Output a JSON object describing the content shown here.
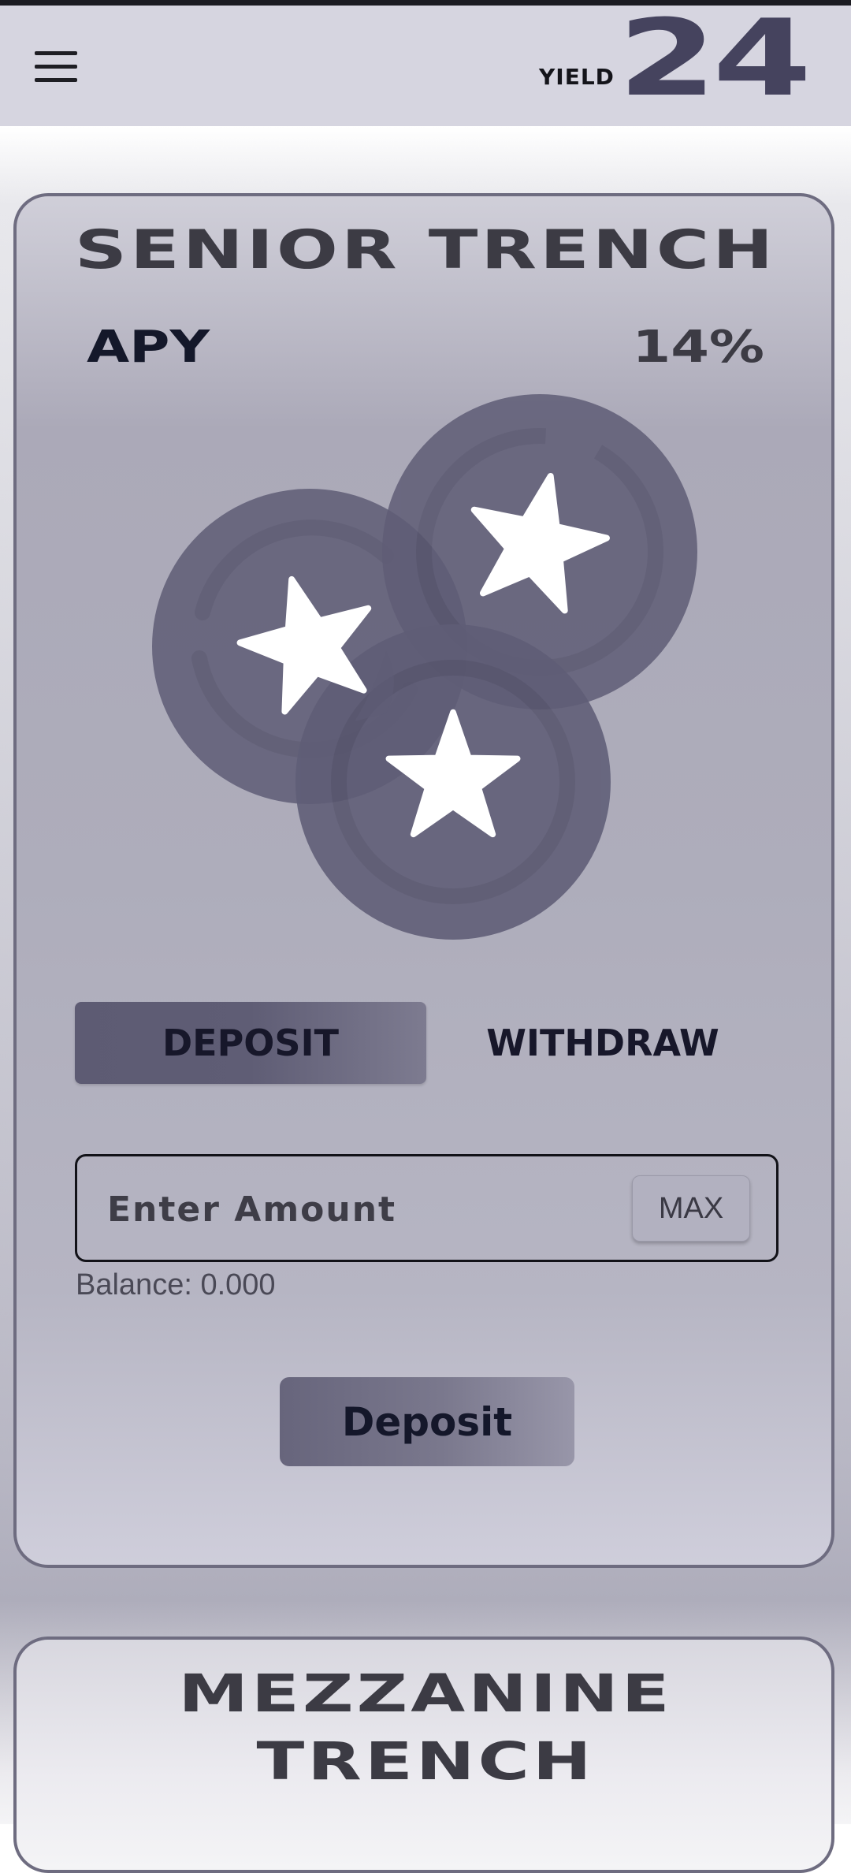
{
  "header": {
    "logo_small": "YIELD",
    "logo_big": "24"
  },
  "senior_card": {
    "title": "SENIOR TRENCH",
    "apy_label": "APY",
    "apy_value": "14%",
    "tabs": {
      "deposit": "DEPOSIT",
      "withdraw": "WITHDRAW"
    },
    "amount_placeholder": "Enter Amount",
    "max_label": "MAX",
    "balance_text": "Balance: 0.000",
    "deposit_button": "Deposit"
  },
  "mezzanine_card": {
    "title_line1": "MEZZANINE",
    "title_line2": "TRENCH"
  },
  "colors": {
    "header_bg": "#d6d5e0",
    "coin_fill": "#5f5d76",
    "accent": "#45435e"
  },
  "icons": [
    "hamburger-menu-icon",
    "star-coins-illustration"
  ]
}
